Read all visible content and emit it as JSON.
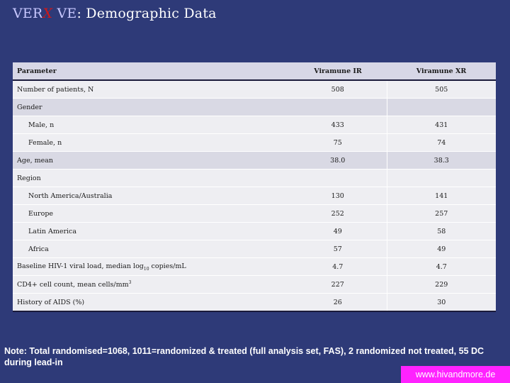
{
  "title": {
    "brand_prefix": "VER",
    "brand_x": "X",
    "brand_suffix": " VE",
    "rest": ": Demographic Data"
  },
  "table": {
    "headers": [
      "Parameter",
      "Viramune IR",
      "Viramune XR"
    ],
    "rows": [
      {
        "label": "Number of patients, N",
        "ir": "508",
        "xr": "505",
        "style": "light",
        "indent": false
      },
      {
        "label": "Gender",
        "ir": "",
        "xr": "",
        "style": "dark",
        "indent": false
      },
      {
        "label": "Male, n",
        "ir": "433",
        "xr": "431",
        "style": "light",
        "indent": true
      },
      {
        "label": "Female, n",
        "ir": "75",
        "xr": "74",
        "style": "light",
        "indent": true
      },
      {
        "label": "Age, mean",
        "ir": "38.0",
        "xr": "38.3",
        "style": "dark",
        "indent": false
      },
      {
        "label": "Region",
        "ir": "",
        "xr": "",
        "style": "light",
        "indent": false
      },
      {
        "label": "North America/Australia",
        "ir": "130",
        "xr": "141",
        "style": "light",
        "indent": true
      },
      {
        "label": "Europe",
        "ir": "252",
        "xr": "257",
        "style": "light",
        "indent": true
      },
      {
        "label": "Latin America",
        "ir": "49",
        "xr": "58",
        "style": "light",
        "indent": true
      },
      {
        "label": "Africa",
        "ir": "57",
        "xr": "49",
        "style": "light",
        "indent": true
      },
      {
        "label": "Baseline HIV-1 viral load, median log10 copies/mL",
        "ir": "4.7",
        "xr": "4.7",
        "style": "light",
        "indent": false
      },
      {
        "label": "CD4+ cell count, mean cells/mm3",
        "ir": "227",
        "xr": "229",
        "style": "light",
        "indent": false
      },
      {
        "label": "History of AIDS (%)",
        "ir": "26",
        "xr": "30",
        "style": "light",
        "indent": false
      }
    ]
  },
  "note": "Note: Total randomised=1068, 1011=randomized & treated (full analysis set, FAS), 2 randomized not treated, 55 DC during lead-in",
  "website": "www.hivandmore.de",
  "colors": {
    "background": "#2e3a78",
    "website_badge": "#ff22ff",
    "brand_x": "#d01818"
  }
}
